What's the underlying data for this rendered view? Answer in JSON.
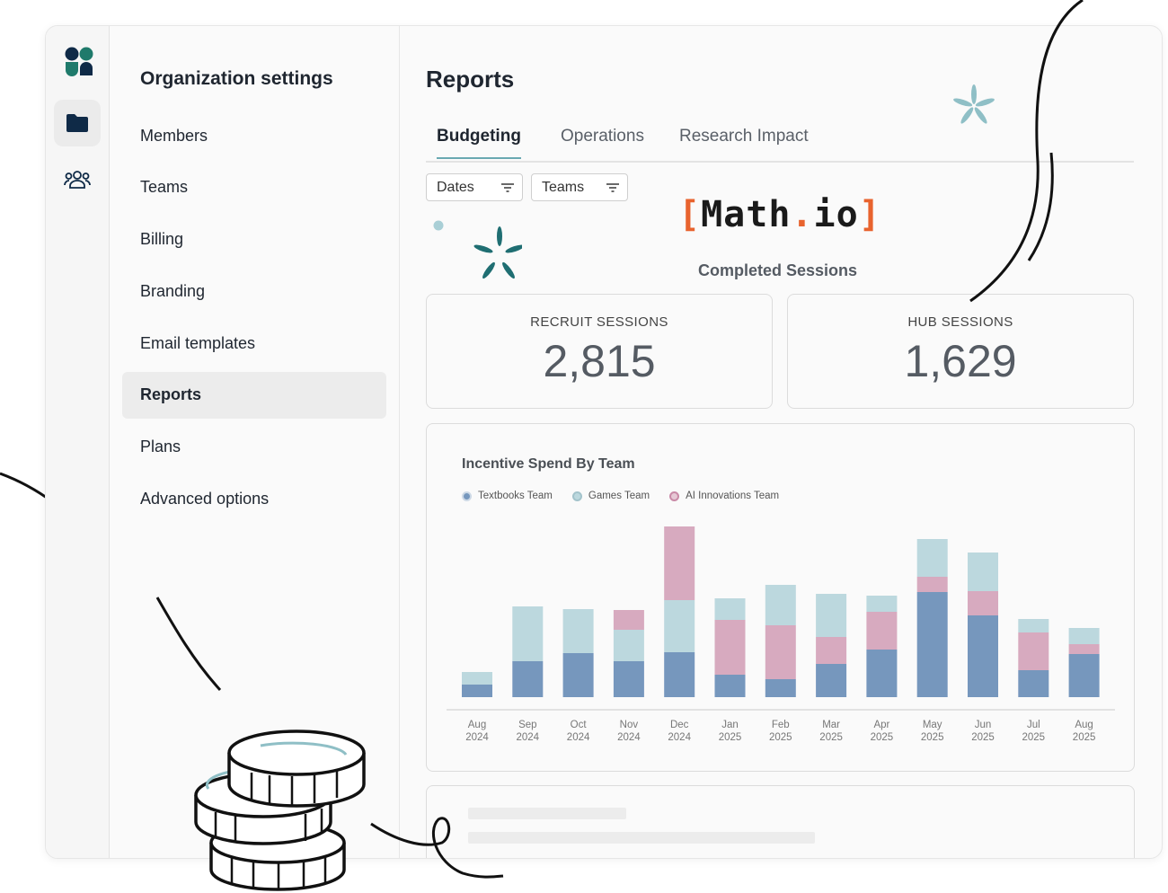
{
  "rail": {
    "logo_icon": "org-logo-icon",
    "items": [
      {
        "icon": "folder-icon",
        "active": true
      },
      {
        "icon": "users-icon",
        "active": false
      }
    ]
  },
  "sidebar": {
    "title": "Organization settings",
    "items": [
      {
        "label": "Members",
        "active": false
      },
      {
        "label": "Teams",
        "active": false
      },
      {
        "label": "Billing",
        "active": false
      },
      {
        "label": "Branding",
        "active": false
      },
      {
        "label": "Email templates",
        "active": false
      },
      {
        "label": "Reports",
        "active": true
      },
      {
        "label": "Plans",
        "active": false
      },
      {
        "label": "Advanced options",
        "active": false
      }
    ]
  },
  "main": {
    "title": "Reports",
    "tabs": [
      {
        "label": "Budgeting",
        "active": true
      },
      {
        "label": "Operations",
        "active": false
      },
      {
        "label": "Research Impact",
        "active": false
      }
    ],
    "filters": [
      {
        "label": "Dates",
        "icon": "filter-icon"
      },
      {
        "label": "Teams",
        "icon": "filter-icon"
      }
    ],
    "brand": {
      "open": "[",
      "part1": "Math",
      "dot": ".",
      "part2": "io",
      "close": "]"
    },
    "completed_title": "Completed Sessions",
    "cards": [
      {
        "label": "RECRUIT SESSIONS",
        "value": "2,815"
      },
      {
        "label": "HUB SESSIONS",
        "value": "1,629"
      }
    ]
  },
  "colors": {
    "textbooks": "#7697bd",
    "games": "#bcd8de",
    "ai": "#d7aabf",
    "brand_orange": "#e8632e",
    "tab_accent": "#6aa9b2",
    "logo_dark": "#0f2a47",
    "logo_teal": "#1f7a6b"
  },
  "chart_data": {
    "type": "bar",
    "stacked": true,
    "title": "Incentive Spend By Team",
    "categories": [
      [
        "Aug",
        "2024"
      ],
      [
        "Sep",
        "2024"
      ],
      [
        "Oct",
        "2024"
      ],
      [
        "Nov",
        "2024"
      ],
      [
        "Dec",
        "2024"
      ],
      [
        "Jan",
        "2025"
      ],
      [
        "Feb",
        "2025"
      ],
      [
        "Mar",
        "2025"
      ],
      [
        "Apr",
        "2025"
      ],
      [
        "May",
        "2025"
      ],
      [
        "Jun",
        "2025"
      ],
      [
        "Jul",
        "2025"
      ],
      [
        "Aug",
        "2025"
      ]
    ],
    "series": [
      {
        "name": "Textbooks Team",
        "color": "#7697bd",
        "values": [
          14,
          40,
          49,
          40,
          50,
          25,
          20,
          37,
          53,
          117,
          91,
          30,
          48
        ]
      },
      {
        "name": "Games Team",
        "color": "#bcd8de",
        "values": [
          14,
          61,
          49,
          35,
          58,
          24,
          45,
          48,
          18,
          42,
          43,
          15,
          18
        ]
      },
      {
        "name": "AI Innovations Team",
        "color": "#d7aabf",
        "values": [
          0,
          0,
          0,
          22,
          82,
          61,
          60,
          30,
          42,
          17,
          27,
          42,
          11
        ]
      }
    ],
    "stack_order": [
      "Textbooks Team",
      "AI Innovations Team",
      "Games Team"
    ],
    "stack_order_nov_dec": [
      "Textbooks Team",
      "Games Team",
      "AI Innovations Team"
    ],
    "ylim": [
      0,
      200
    ],
    "grid": false,
    "legend": "top-left"
  }
}
